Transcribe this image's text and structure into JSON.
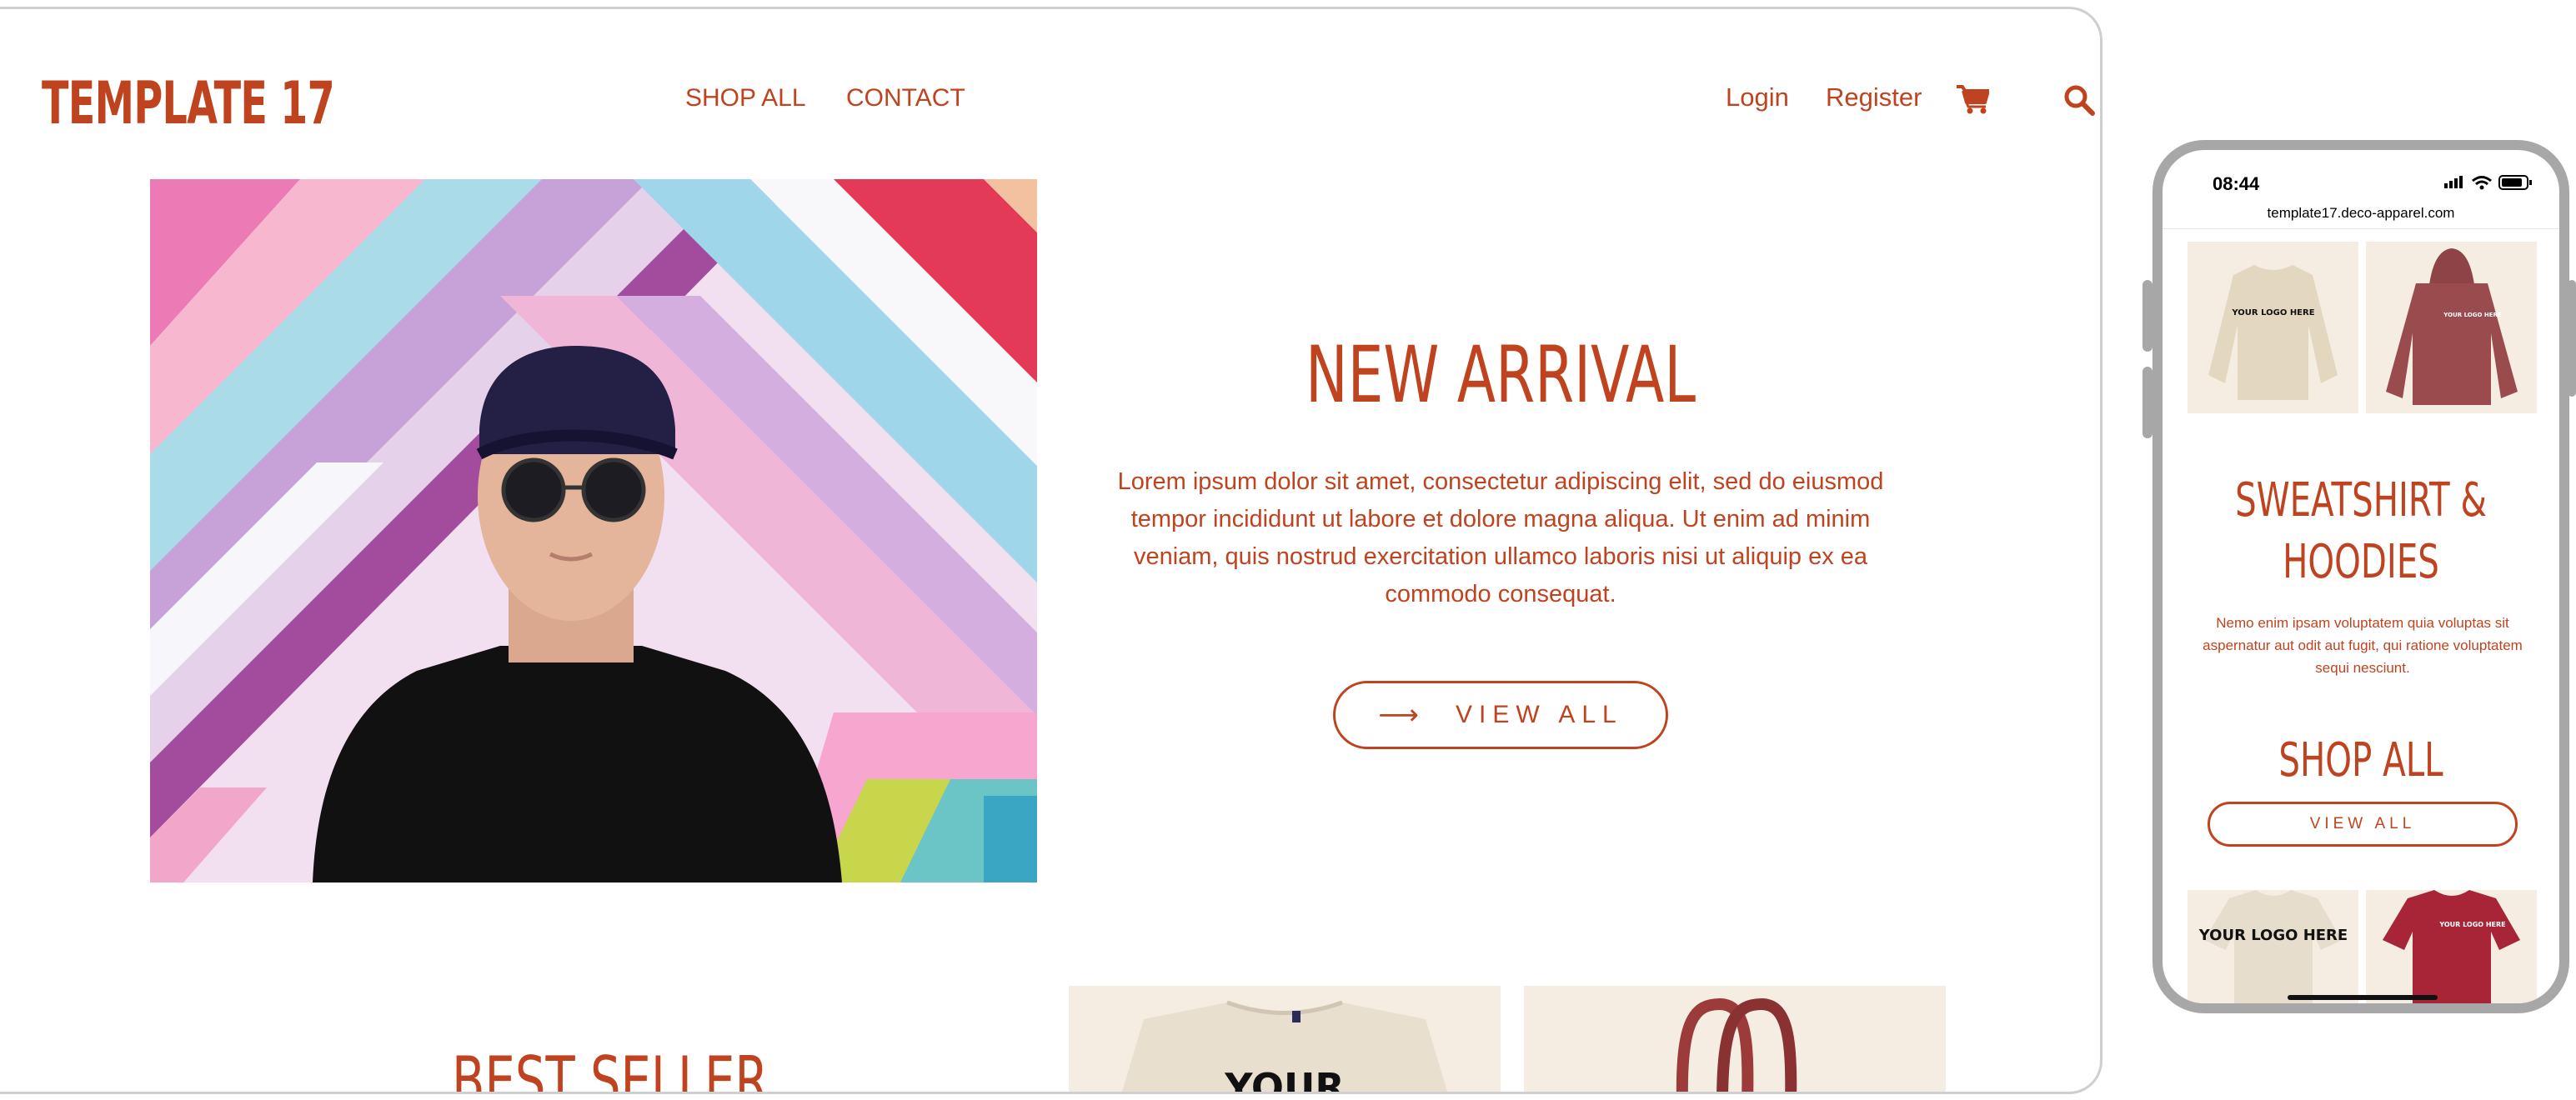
{
  "desktop": {
    "logo": "TEMPLATE 17",
    "nav": {
      "shop_all": "SHOP ALL",
      "contact": "CONTACT",
      "login": "Login",
      "register": "Register"
    },
    "icons": {
      "cart": "cart-icon",
      "search": "search-icon"
    },
    "hero": {
      "title": "NEW ARRIVAL",
      "text": "Lorem ipsum dolor sit amet, consectetur adipiscing elit, sed do eiusmod tempor incididunt ut labore et dolore magna aliqua. Ut enim ad minim veniam, quis nostrud exercitation ullamco laboris nisi ut aliquip ex ea commodo consequat.",
      "button": "VIEW ALL"
    },
    "best_seller_title": "BEST SELLER",
    "tee_print": "YOUR"
  },
  "phone": {
    "time": "08:44",
    "url": "template17.deco-apparel.com",
    "sweatshirt_print": "YOUR LOGO HERE",
    "hoodie_print": "YOUR LOGO HERE",
    "section1_title_line1": "SWEATSHIRT &",
    "section1_title_line2": "HOODIES",
    "section1_text": "Nemo enim ipsam voluptatem quia voluptas sit aspernatur aut odit aut fugit, qui ratione voluptatem sequi nesciunt.",
    "section2_title": "SHOP ALL",
    "section2_button": "VIEW ALL",
    "tee_cream_print": "YOUR LOGO HERE",
    "tee_red_print": "YOUR LOGO HERE"
  },
  "colors": {
    "accent": "#c0431f",
    "tile_bg": "#f6ede2"
  }
}
